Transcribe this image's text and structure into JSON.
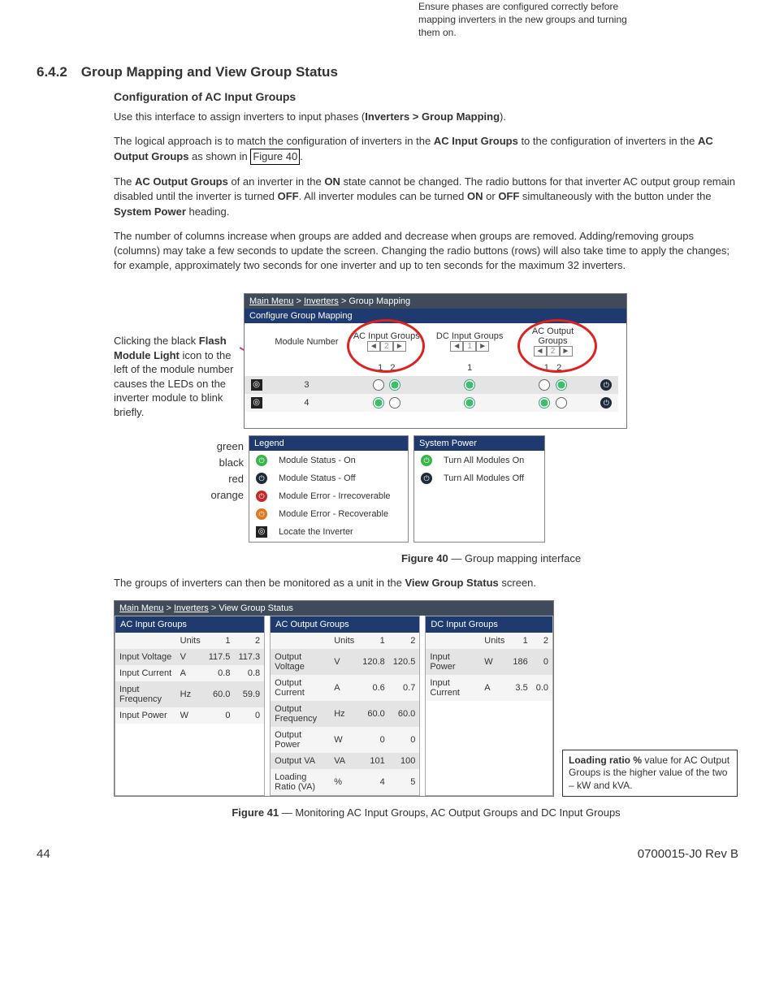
{
  "noteTop": "Ensure phases are configured correctly before mapping inverters in the new groups and turning them on.",
  "h642": "6.4.2 Group Mapping and View Group Status",
  "h3cfg": "Configuration of AC Input Groups",
  "p1a": "Use this interface to assign inverters to input phases (",
  "p1b": "Inverters > Group Mapping",
  "p1c": ").",
  "p2a": "The logical approach is to match the configuration of inverters in the ",
  "p2b": "AC Input Groups",
  "p2c": " to the configuration of inverters in the ",
  "p2d": "AC Output Groups",
  "p2e": " as shown in ",
  "p2link": "Figure 40",
  "p2f": ".",
  "p3a": "The ",
  "p3b": "AC Output Groups",
  "p3c": " of an inverter in the ",
  "p3d": "ON",
  "p3e": " state cannot be changed. The radio buttons for that inverter AC output group remain disabled until the inverter is turned ",
  "p3f": "OFF",
  "p3g": ". All inverter modules can be turned ",
  "p3h": "ON",
  "p3i": " or ",
  "p3j": "OFF",
  "p3k": " simultaneously with the button under the ",
  "p3l": "System Power",
  "p3m": " heading.",
  "p4": "The number of columns increase when groups are added and decrease when groups are removed. Adding/removing groups (columns) may take a few seconds to update the screen. Changing the radio buttons (rows) will also take time to apply the changes; for example, approximately two seconds for one inverter and up to ten seconds for the maximum 32 inverters.",
  "leftNote1": "Clicking the black ",
  "leftNote2": "Flash Module Light",
  "leftNote3": " icon to the left of the module number causes the LEDs on the inverter module to blink briefly.",
  "legendLabels": {
    "green": "green",
    "black": "black",
    "red": "red",
    "orange": "orange"
  },
  "fig40": {
    "crumb1": "Main Menu",
    "crumb2": "Inverters",
    "crumb3": "Group Mapping",
    "sub": "Configure Group Mapping",
    "colModNum": "Module Number",
    "colAC": "AC Input Groups",
    "colDC": "DC Input Groups",
    "colACout": "AC Output Groups",
    "num1": "1",
    "num2": "2",
    "row1mod": "3",
    "row2mod": "4",
    "legendHead": "Legend",
    "legend": {
      "on": "Module Status - On",
      "off": "Module Status - Off",
      "errI": "Module Error - Irrecoverable",
      "errR": "Module Error - Recoverable",
      "locate": "Locate the Inverter"
    },
    "powerHead": "System Power",
    "power": {
      "on": "Turn All Modules On",
      "off": "Turn All Modules Off"
    },
    "caption": "Figure 40  —  Group mapping interface"
  },
  "p5a": "The groups of inverters can then be monitored as a unit in the ",
  "p5b": "View Group Status",
  "p5c": " screen.",
  "fig41": {
    "crumb1": "Main Menu",
    "crumb2": "Inverters",
    "crumb3": "View Group Status",
    "hdrAC": "AC Input Groups",
    "hdrACout": "AC Output Groups",
    "hdrDC": "DC Input Groups",
    "units": "Units",
    "c1": "1",
    "c2": "2",
    "ac": {
      "r1": {
        "l": "Input Voltage",
        "u": "V",
        "v1": "117.5",
        "v2": "117.3"
      },
      "r2": {
        "l": "Input Current",
        "u": "A",
        "v1": "0.8",
        "v2": "0.8"
      },
      "r3": {
        "l": "Input Frequency",
        "u": "Hz",
        "v1": "60.0",
        "v2": "59.9"
      },
      "r4": {
        "l": "Input Power",
        "u": "W",
        "v1": "0",
        "v2": "0"
      }
    },
    "acout": {
      "r1": {
        "l": "Output Voltage",
        "u": "V",
        "v1": "120.8",
        "v2": "120.5"
      },
      "r2": {
        "l": "Output Current",
        "u": "A",
        "v1": "0.6",
        "v2": "0.7"
      },
      "r3": {
        "l": "Output Frequency",
        "u": "Hz",
        "v1": "60.0",
        "v2": "60.0"
      },
      "r4": {
        "l": "Output Power",
        "u": "W",
        "v1": "0",
        "v2": "0"
      },
      "r5": {
        "l": "Output VA",
        "u": "VA",
        "v1": "101",
        "v2": "100"
      },
      "r6": {
        "l": "Loading Ratio (VA)",
        "u": "%",
        "v1": "4",
        "v2": "5"
      }
    },
    "dc": {
      "r1": {
        "l": "Input Power",
        "u": "W",
        "v1": "186",
        "v2": "0"
      },
      "r2": {
        "l": "Input Current",
        "u": "A",
        "v1": "3.5",
        "v2": "0.0"
      }
    },
    "noteA": "Loading ratio %",
    "noteB": " value for AC Output Groups is the higher value of the two – kW and kVA.",
    "caption": "Figure 41  —  Monitoring AC Input Groups, AC Output Groups and DC Input Groups"
  },
  "footer": {
    "page": "44",
    "doc": "0700015-J0    Rev B"
  }
}
